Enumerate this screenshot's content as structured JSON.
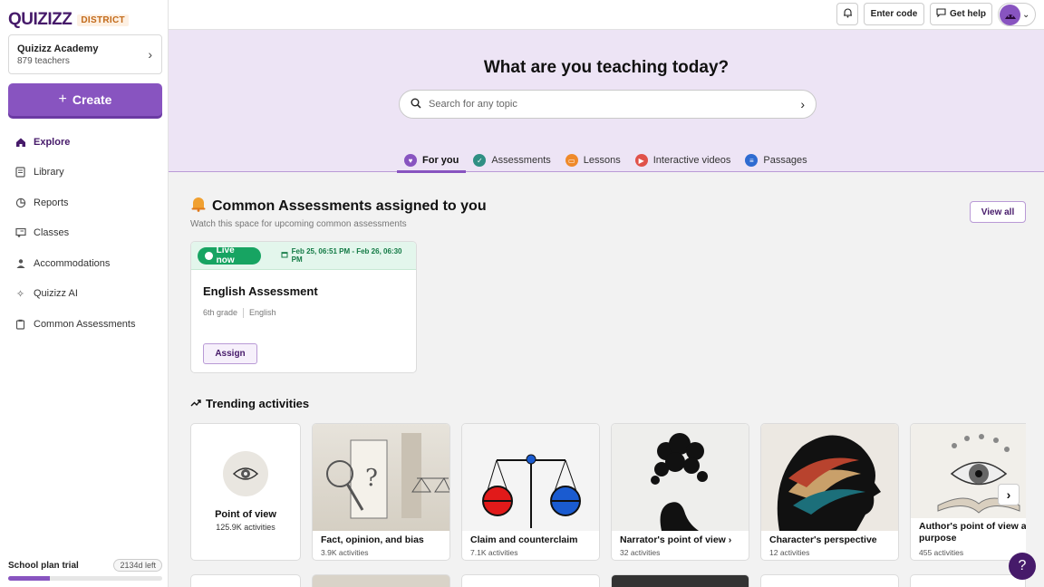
{
  "brand": {
    "name": "QUIZIZZ",
    "tag": "DISTRICT"
  },
  "org": {
    "name": "Quizizz Academy",
    "teachers": "879 teachers"
  },
  "create_label": "Create",
  "nav": [
    {
      "label": "Explore",
      "icon": "home-icon"
    },
    {
      "label": "Library",
      "icon": "library-icon"
    },
    {
      "label": "Reports",
      "icon": "reports-icon"
    },
    {
      "label": "Classes",
      "icon": "classes-icon"
    },
    {
      "label": "Accommodations",
      "icon": "accommodations-icon"
    },
    {
      "label": "Quizizz AI",
      "icon": "sparkle-icon"
    },
    {
      "label": "Common Assessments",
      "icon": "clipboard-icon"
    }
  ],
  "trial": {
    "label": "School plan trial",
    "days_left": "2134d left",
    "progress": 0.27
  },
  "topbar": {
    "enter_code": "Enter code",
    "get_help": "Get help"
  },
  "hero": {
    "title": "What are you teaching today?",
    "search_placeholder": "Search for any topic"
  },
  "tabs": [
    {
      "label": "For you",
      "color": "#8854c0",
      "active": true
    },
    {
      "label": "Assessments",
      "color": "#2f8f83"
    },
    {
      "label": "Lessons",
      "color": "#ef8a2a"
    },
    {
      "label": "Interactive videos",
      "color": "#e0524a"
    },
    {
      "label": "Passages",
      "color": "#2e6bd1"
    }
  ],
  "common": {
    "title": "Common Assessments assigned to you",
    "subtitle": "Watch this space for upcoming common assessments",
    "view_all": "View all",
    "card": {
      "status": "Live now",
      "dates": "Feb 25, 06:51 PM - Feb 26, 06:30 PM",
      "title": "English Assessment",
      "grade": "6th grade",
      "subject": "English",
      "assign": "Assign"
    }
  },
  "trending": {
    "title": "Trending activities",
    "cards": [
      {
        "title": "Point of view",
        "count": "125.9K activities"
      },
      {
        "title": "Fact, opinion, and bias",
        "count": "3.9K activities"
      },
      {
        "title": "Claim and counterclaim",
        "count": "7.1K activities"
      },
      {
        "title": "Narrator's point of view",
        "count": "32 activities"
      },
      {
        "title": "Character's perspective",
        "count": "12 activities"
      },
      {
        "title": "Author's point of view and purpose",
        "count": "455 activities"
      }
    ]
  },
  "help_label": "?"
}
